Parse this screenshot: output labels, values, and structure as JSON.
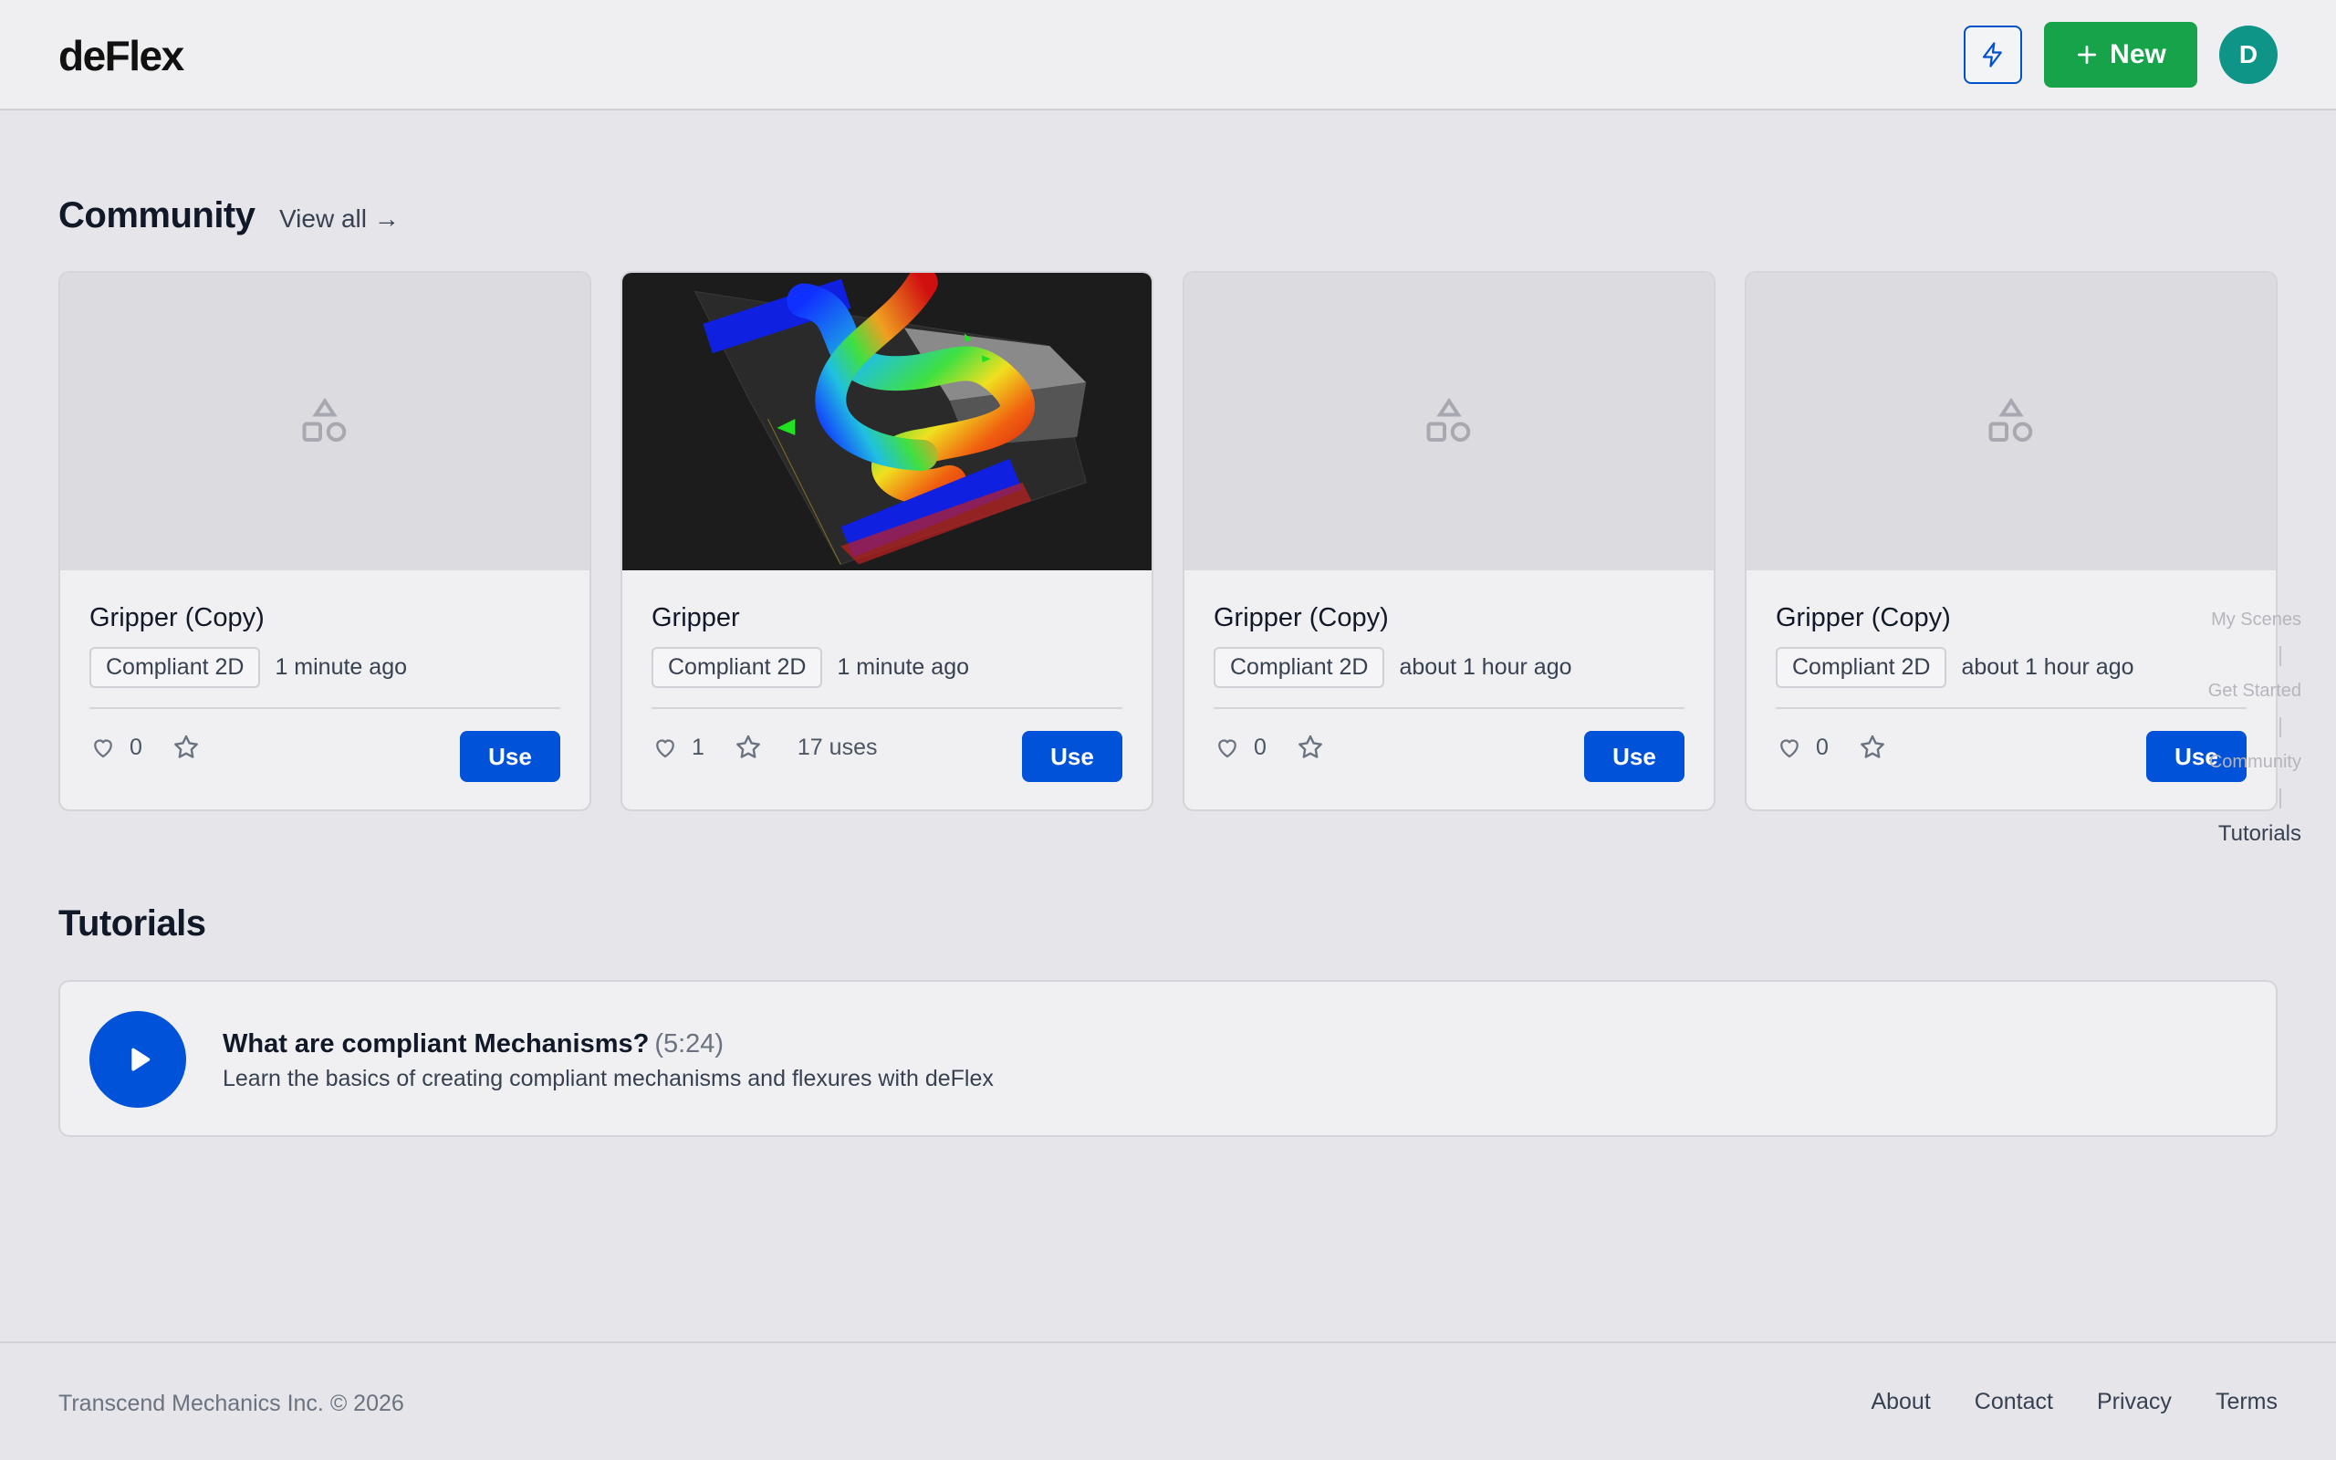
{
  "header": {
    "logo": "deFlex",
    "new_label": "New",
    "avatar_initial": "D"
  },
  "community": {
    "title": "Community",
    "view_all": "View all →",
    "cards": [
      {
        "title": "Gripper (Copy)",
        "tag": "Compliant 2D",
        "time": "1 minute ago",
        "likes": "0",
        "uses": "",
        "use_label": "Use",
        "thumbnail": "placeholder-shapes-icon"
      },
      {
        "title": "Gripper",
        "tag": "Compliant 2D",
        "time": "1 minute ago",
        "likes": "1",
        "uses": "17 uses",
        "use_label": "Use",
        "thumbnail": "simulation-render"
      },
      {
        "title": "Gripper (Copy)",
        "tag": "Compliant 2D",
        "time": "about 1 hour ago",
        "likes": "0",
        "uses": "",
        "use_label": "Use",
        "thumbnail": "placeholder-shapes-icon"
      },
      {
        "title": "Gripper (Copy)",
        "tag": "Compliant 2D",
        "time": "about 1 hour ago",
        "likes": "0",
        "uses": "",
        "use_label": "Use",
        "thumbnail": "placeholder-shapes-icon"
      }
    ]
  },
  "side_nav": {
    "items": [
      "My Scenes",
      "Get Started",
      "Community",
      "Tutorials"
    ],
    "active": "Tutorials"
  },
  "tutorials": {
    "title": "Tutorials",
    "items": [
      {
        "title": "What are compliant Mechanisms?",
        "duration": "(5:24)",
        "description": "Learn the basics of creating compliant mechanisms and flexures with deFlex"
      }
    ]
  },
  "footer": {
    "copyright": "Transcend Mechanics Inc. © 2026",
    "links": [
      "About",
      "Contact",
      "Privacy",
      "Terms"
    ]
  },
  "colors": {
    "accent_blue": "#0052d9",
    "new_green": "#16a34a",
    "avatar_teal": "#0f9488"
  }
}
